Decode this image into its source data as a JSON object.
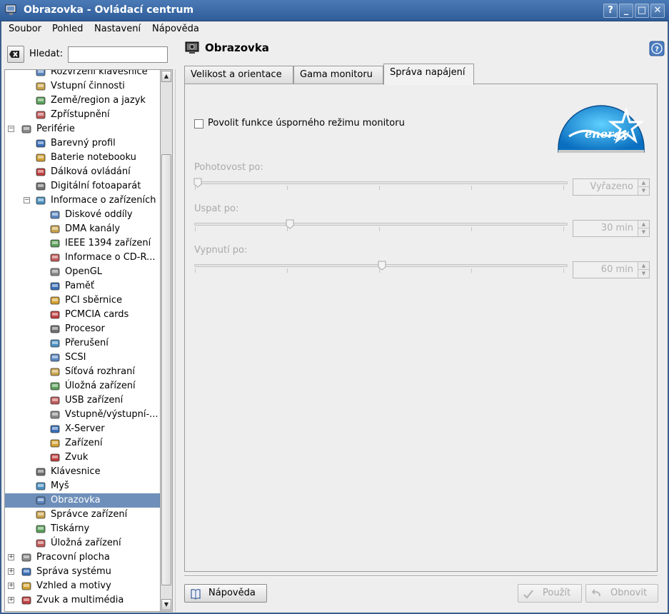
{
  "window": {
    "title": "Obrazovka - Ovládací centrum",
    "buttons": [
      "?",
      "_",
      "□",
      "✕"
    ]
  },
  "menubar": {
    "items": [
      "Soubor",
      "Pohled",
      "Nastavení",
      "Nápověda"
    ]
  },
  "search": {
    "label": "Hledat:",
    "value": ""
  },
  "tree": {
    "items": [
      {
        "label": "Rozvržení klávesnice",
        "level": 1,
        "icon": "keyboard-layout-icon"
      },
      {
        "label": "Vstupní činnosti",
        "level": 1,
        "icon": "keyboard-icon"
      },
      {
        "label": "Země/region a jazyk",
        "level": 1,
        "icon": "flag-icon"
      },
      {
        "label": "Zpřístupnění",
        "level": 1,
        "icon": "accessibility-icon"
      },
      {
        "label": "Periférie",
        "level": 0,
        "icon": "mouse-peripheral-icon",
        "expanded": true
      },
      {
        "label": "Barevný profil",
        "level": 1,
        "icon": "color-profile-icon"
      },
      {
        "label": "Baterie notebooku",
        "level": 1,
        "icon": "battery-icon"
      },
      {
        "label": "Dálková ovládání",
        "level": 1,
        "icon": "remote-control-icon"
      },
      {
        "label": "Digitální fotoaparát",
        "level": 1,
        "icon": "camera-icon"
      },
      {
        "label": "Informace o zařízeních",
        "level": 1,
        "icon": "device-info-icon",
        "expanded": true
      },
      {
        "label": "Diskové oddíly",
        "level": 2,
        "icon": "disk-partition-icon"
      },
      {
        "label": "DMA kanály",
        "level": 2,
        "icon": "dma-icon"
      },
      {
        "label": "IEEE 1394 zařízení",
        "level": 2,
        "icon": "firewire-icon"
      },
      {
        "label": "Informace o CD-R...",
        "level": 2,
        "icon": "cdrom-icon"
      },
      {
        "label": "OpenGL",
        "level": 2,
        "icon": "opengl-icon"
      },
      {
        "label": "Paměť",
        "level": 2,
        "icon": "memory-icon"
      },
      {
        "label": "PCI sběrnice",
        "level": 2,
        "icon": "pci-bus-icon"
      },
      {
        "label": "PCMCIA cards",
        "level": 2,
        "icon": "pcmcia-icon"
      },
      {
        "label": "Procesor",
        "level": 2,
        "icon": "processor-icon"
      },
      {
        "label": "Přerušení",
        "level": 2,
        "icon": "interrupt-icon"
      },
      {
        "label": "SCSI",
        "level": 2,
        "icon": "scsi-icon"
      },
      {
        "label": "Síťová rozhraní",
        "level": 2,
        "icon": "network-interface-icon"
      },
      {
        "label": "Úložná zařízení",
        "level": 2,
        "icon": "storage-device-icon"
      },
      {
        "label": "USB zařízení",
        "level": 2,
        "icon": "usb-icon"
      },
      {
        "label": "Vstupně/výstupní-...",
        "level": 2,
        "icon": "io-ports-icon"
      },
      {
        "label": "X-Server",
        "level": 2,
        "icon": "x-server-icon"
      },
      {
        "label": "Zařízení",
        "level": 2,
        "icon": "devices-icon"
      },
      {
        "label": "Zvuk",
        "level": 2,
        "icon": "sound-icon"
      },
      {
        "label": "Klávesnice",
        "level": 1,
        "icon": "keyboard-icon"
      },
      {
        "label": "Myš",
        "level": 1,
        "icon": "mouse-icon"
      },
      {
        "label": "Obrazovka",
        "level": 1,
        "icon": "display-icon",
        "selected": true
      },
      {
        "label": "Správce zařízení",
        "level": 1,
        "icon": "device-manager-icon"
      },
      {
        "label": "Tiskárny",
        "level": 1,
        "icon": "printer-icon"
      },
      {
        "label": "Úložná zařízení",
        "level": 1,
        "icon": "storage-icon"
      },
      {
        "label": "Pracovní plocha",
        "level": 0,
        "icon": "desktop-icon",
        "expanded": false
      },
      {
        "label": "Správa systému",
        "level": 0,
        "icon": "system-admin-icon",
        "expanded": false
      },
      {
        "label": "Vzhled a motivy",
        "level": 0,
        "icon": "appearance-icon",
        "expanded": false
      },
      {
        "label": "Zvuk a multimédia",
        "level": 0,
        "icon": "multimedia-icon",
        "expanded": false
      }
    ]
  },
  "module": {
    "title": "Obrazovka"
  },
  "tabs": [
    {
      "label": "Velikost a orientace",
      "active": false
    },
    {
      "label": "Gama monitoru",
      "active": false
    },
    {
      "label": "Správa napájení",
      "active": true
    }
  ],
  "power": {
    "enable_label": "Povolit funkce úsporného režimu monitoru",
    "enabled": false,
    "sliders": [
      {
        "label": "Pohotovost po:",
        "value": "Vyřazeno",
        "position": 0.0
      },
      {
        "label": "Uspat po:",
        "value": "30 min",
        "position": 0.25
      },
      {
        "label": "Vypnutí po:",
        "value": "60 min",
        "position": 0.5
      }
    ]
  },
  "buttons": {
    "help": "Nápověda",
    "apply": "Použít",
    "reset": "Obnovit"
  },
  "colors": {
    "titlebar": "#3a6aa8",
    "selection": "#6e8fb9"
  }
}
